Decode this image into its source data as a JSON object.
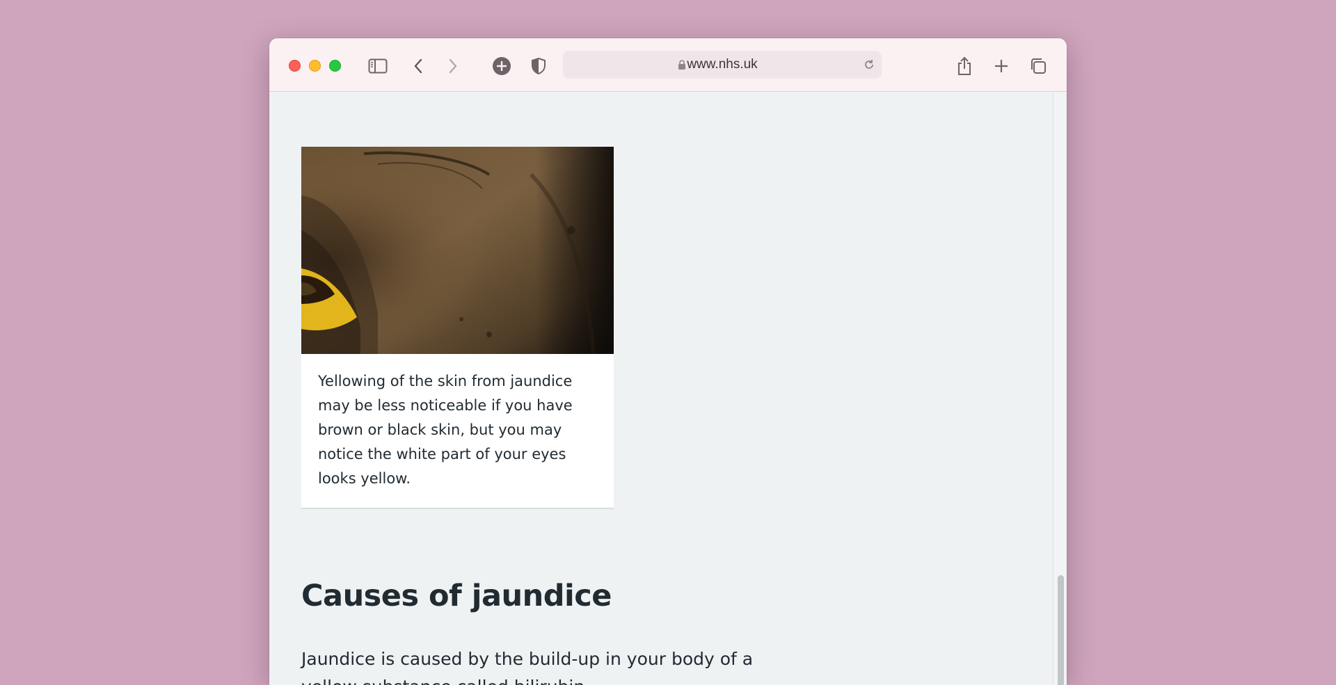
{
  "browser": {
    "url": "www.nhs.uk",
    "icons": [
      "sidebar-icon",
      "back-icon",
      "forward-icon",
      "extensions-icon",
      "privacy-shield-icon",
      "lock-icon",
      "reload-icon",
      "share-icon",
      "new-tab-icon",
      "tab-overview-icon"
    ]
  },
  "page": {
    "figure_caption": "Yellowing of the skin from jaundice may be less noticeable if you have brown or black skin, but you may notice the white part of your eyes looks yellow.",
    "heading": "Causes of jaundice",
    "paragraph": "Jaundice is caused by the build-up in your body of a yellow substance called bilirubin."
  },
  "colors": {
    "page_background": "#eff2f3",
    "text": "#212b32",
    "desktop": "#cea5bc"
  }
}
